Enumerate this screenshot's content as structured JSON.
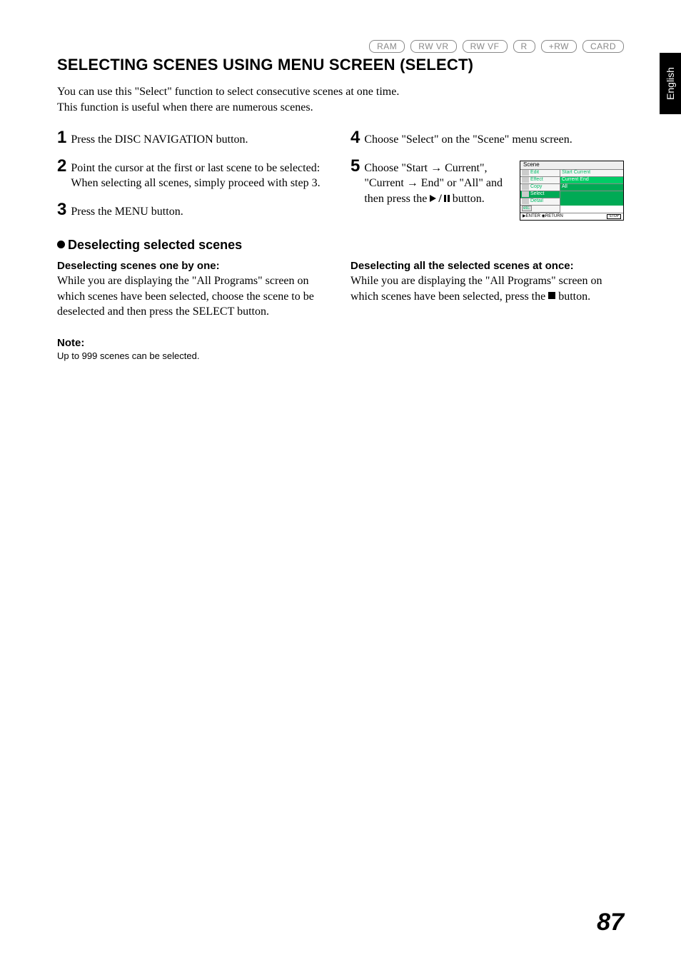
{
  "side_tab": "English",
  "badges": [
    "RAM",
    "RW VR",
    "RW VF",
    "R",
    "+RW",
    "CARD"
  ],
  "heading": "SELECTING SCENES USING MENU SCREEN (SELECT)",
  "intro_line1": "You can use this \"Select\" function to select consecutive scenes at one time.",
  "intro_line2": "This function is useful when there are numerous scenes.",
  "steps": {
    "s1": "Press the DISC NAVIGATION button.",
    "s2": "Point the cursor at the first or last scene to be selected: When selecting all scenes, simply proceed with step 3.",
    "s3": "Press the MENU button.",
    "s4": "Choose \"Select\" on the \"Scene\" menu screen.",
    "s5a": "Choose \"Start → Current\", \"Current → End\" or \"All\" and then press the ",
    "s5b": " button."
  },
  "sub_heading": "Deselecting selected scenes",
  "left_sec_title": "Deselecting scenes one by one:",
  "left_sec_body": "While you are displaying the \"All Programs\" screen on which scenes have been selected, choose the scene to be deselected and then press the SELECT button.",
  "right_sec_title": "Deselecting all the selected scenes at once:",
  "right_sec_body_a": "While you are displaying the \"All Programs\" screen on which scenes have been selected, press the ",
  "right_sec_body_b": " button.",
  "note_label": "Note:",
  "note_body": "Up to 999 scenes can be selected.",
  "page_number": "87",
  "menu": {
    "title": "Scene",
    "left_items": [
      "Edit",
      "Effect",
      "Copy",
      "Select",
      "Detail"
    ],
    "etc": "etc.",
    "right_items": [
      "Start Current",
      "Current End",
      "All"
    ],
    "foot_enter": "ENTER",
    "foot_return": "RETURN",
    "foot_stop": "STOP"
  }
}
